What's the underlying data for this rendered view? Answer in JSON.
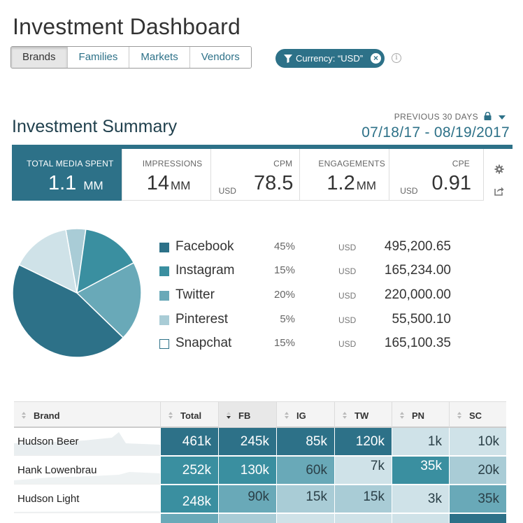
{
  "header": {
    "title": "Investment Dashboard"
  },
  "tabs": [
    {
      "label": "Brands",
      "active": true
    },
    {
      "label": "Families",
      "active": false
    },
    {
      "label": "Markets",
      "active": false
    },
    {
      "label": "Vendors",
      "active": false
    }
  ],
  "filter": {
    "label": "Currency: “USD”",
    "icon": "funnel-icon",
    "clear_icon": "close-icon"
  },
  "summary": {
    "title": "Investment Summary",
    "period_label": "PREVIOUS 30 DAYS",
    "date_range": "07/18/17 - 08/19/2017"
  },
  "kpis": {
    "total": {
      "label": "TOTAL MEDIA SPENT",
      "value": "1.1",
      "unit": "MM"
    },
    "impressions": {
      "label": "IMPRESSIONS",
      "value": "14",
      "unit": "MM"
    },
    "cpm": {
      "label": "CPM",
      "currency": "USD",
      "value": "78.5"
    },
    "engagements": {
      "label": "ENGAGEMENTS",
      "value": "1.2",
      "unit": "MM"
    },
    "cpe": {
      "label": "CPE",
      "currency": "USD",
      "value": "0.91"
    }
  },
  "chart_data": {
    "type": "pie",
    "labels": [
      "Facebook",
      "Instagram",
      "Twitter",
      "Pinterest",
      "Snapchat"
    ],
    "values": [
      45,
      15,
      20,
      5,
      15
    ],
    "colors": [
      "#2d7188",
      "#3a8fa0",
      "#69a9b8",
      "#a9ccd6",
      "#cfe2e8"
    ]
  },
  "legend": [
    {
      "name": "Facebook",
      "pct": "45%",
      "currency": "USD",
      "amount": "495,200.65",
      "color": "#2d7188"
    },
    {
      "name": "Instagram",
      "pct": "15%",
      "currency": "USD",
      "amount": "165,234.00",
      "color": "#3a8fa0"
    },
    {
      "name": "Twitter",
      "pct": "20%",
      "currency": "USD",
      "amount": "220,000.00",
      "color": "#69a9b8"
    },
    {
      "name": "Pinterest",
      "pct": "5%",
      "currency": "USD",
      "amount": "55,500.10",
      "color": "#a9ccd6"
    },
    {
      "name": "Snapchat",
      "pct": "15%",
      "currency": "USD",
      "amount": "165,100.35",
      "color": "#ffffff"
    }
  ],
  "table": {
    "columns": [
      "Brand",
      "Total",
      "FB",
      "IG",
      "TW",
      "PN",
      "SC"
    ],
    "sorted_column": "FB",
    "rows": [
      {
        "brand": "Hudson Beer",
        "cells": [
          "461k",
          "245k",
          "85k",
          "120k",
          "1k",
          "10k"
        ]
      },
      {
        "brand": "Hank Lowenbrau",
        "cells": [
          "252k",
          "130k",
          "60k",
          "7k",
          "35k",
          "20k"
        ]
      },
      {
        "brand": "Hudson Light",
        "cells": [
          "248k",
          "90k",
          "15k",
          "15k",
          "3k",
          "35k"
        ]
      }
    ],
    "cell_colors": [
      [
        "#2d7188",
        "#2d7188",
        "#2d7188",
        "#2d7188",
        "#cfe2e8",
        "#cfe2e8"
      ],
      [
        "#3a8fa0",
        "#3a8fa0",
        "#69a9b8",
        "#cfe2e8",
        "#3a8fa0",
        "#a9ccd6"
      ],
      [
        "#3a8fa0",
        "#69a9b8",
        "#a9ccd6",
        "#a9ccd6",
        "#cfe2e8",
        "#69a9b8"
      ]
    ]
  }
}
